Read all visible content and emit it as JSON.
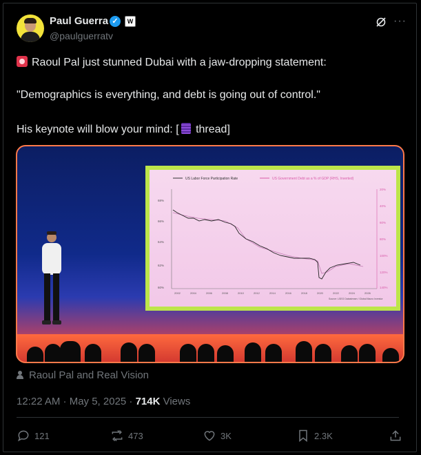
{
  "author": {
    "name": "Paul Guerra",
    "handle": "@paulguerratv",
    "badge_label": "W",
    "verified_mark": "✓"
  },
  "header_icons": [
    "grok-icon",
    "more-icon"
  ],
  "more_label": "···",
  "tweet": {
    "line1": "Raoul Pal just stunned Dubai with a jaw-dropping statement:",
    "line2": "\"Demographics is everything, and debt is going out of control.\"",
    "line3_prefix": "His keynote will blow your mind: [",
    "line3_suffix": " thread]"
  },
  "media": {
    "chart_legend_left": "US Labor Force Participation Rate",
    "chart_legend_right": "US Government Debt as a % of GDP (RHS, Inverted)",
    "y_left_ticks": [
      "68%",
      "66%",
      "64%",
      "62%",
      "60%"
    ],
    "y_right_ticks": [
      "20%",
      "40%",
      "60%",
      "80%",
      "100%",
      "120%",
      "140%"
    ],
    "x_ticks": [
      "2002",
      "2004",
      "2006",
      "2008",
      "2010",
      "2012",
      "2014",
      "2016",
      "2018",
      "2020",
      "2022",
      "2024",
      "2026"
    ],
    "source_note": "Source: LSEG Datastream / Global Macro Investor"
  },
  "attribution": "Raoul Pal and Real Vision",
  "meta": {
    "time_date": "12:22 AM · May 5, 2025 · ",
    "views_count": "714K",
    "views_label": " Views"
  },
  "actions": {
    "replies": "121",
    "reposts": "473",
    "likes": "3K",
    "bookmarks": "2.3K"
  },
  "colors": {
    "background": "#000000",
    "text": "#e7e9ea",
    "muted": "#71767b",
    "verified": "#1d9bf0",
    "media_border": "#ff7a4a",
    "screen_frame": "#bde54a"
  }
}
